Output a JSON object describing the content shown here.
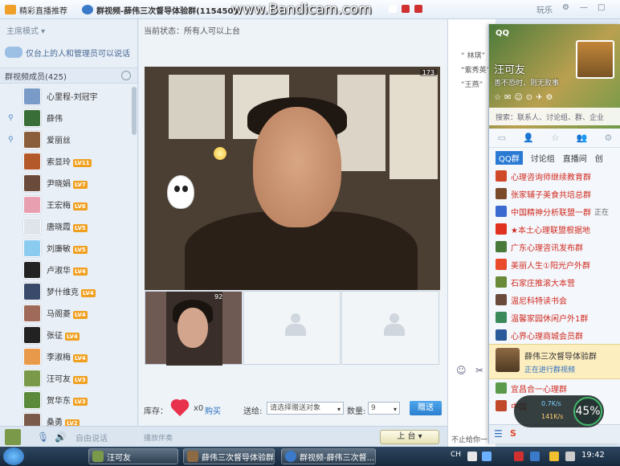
{
  "titlebar": {
    "tab1": "精彩直播推荐",
    "tab2": "群视频-薛伟三次督导体验群(1154500",
    "watermark": "www.Bandicam.com",
    "ctrl1": "玩乐",
    "ctrl2": "ᐯ"
  },
  "left": {
    "mode": "主席模式 ▾",
    "notice": "仅台上的人和管理员可以说话",
    "members_header": "群视频成员(425)",
    "members": [
      {
        "name": "心里程-刘冠宇",
        "lv": "",
        "mic": false,
        "color": "#7a9ac8"
      },
      {
        "name": "薛伟",
        "lv": "",
        "mic": true,
        "color": "#3a6e38"
      },
      {
        "name": "爱丽丝",
        "lv": "",
        "mic": true,
        "color": "#8a5e3a"
      },
      {
        "name": "索显玲",
        "lv": "LV11",
        "mic": false,
        "color": "#b45a2a"
      },
      {
        "name": "尹晓娟",
        "lv": "LV7",
        "mic": false,
        "color": "#6a4a3a"
      },
      {
        "name": "王宏梅",
        "lv": "LV6",
        "mic": false,
        "color": "#e8a0b0"
      },
      {
        "name": "唐晓霞",
        "lv": "LV5",
        "mic": false,
        "color": "#dfe4ea"
      },
      {
        "name": "刘廉敏",
        "lv": "LV5",
        "mic": false,
        "color": "#8ccbf0"
      },
      {
        "name": "卢淑华",
        "lv": "LV4",
        "mic": false,
        "color": "#222222"
      },
      {
        "name": "梦什维克",
        "lv": "LV4",
        "mic": false,
        "color": "#3a4a6a"
      },
      {
        "name": "马阁菱",
        "lv": "LV4",
        "mic": false,
        "color": "#a06a5a"
      },
      {
        "name": "张征",
        "lv": "LV4",
        "mic": false,
        "color": "#222222"
      },
      {
        "name": "李淑梅",
        "lv": "LV4",
        "mic": false,
        "color": "#e89a4a"
      },
      {
        "name": "汪可友",
        "lv": "LV3",
        "mic": false,
        "color": "#7a9a4a"
      },
      {
        "name": "贺华东",
        "lv": "LV3",
        "mic": false,
        "color": "#5a8a3a"
      },
      {
        "name": "桑勇",
        "lv": "LV2",
        "mic": false,
        "color": "#7a5a4a"
      }
    ]
  },
  "center": {
    "status": "当前状态：所有人可以上台",
    "main_count": "173",
    "thumb_count": "92",
    "inventory_label": "库存：",
    "gift_count": "x0",
    "buy": "购买",
    "send_to_label": "送给:",
    "send_to_placeholder": "请选择赠送对象",
    "qty_label": "数量:",
    "qty_value": "9",
    "send_button": "赠送",
    "free_speak": "自由说话",
    "background_music": "播放伴奏",
    "on_stage_button": "上 台"
  },
  "chat": {
    "lines": [
      "“ 林琪”",
      "“紫秀英”",
      "“王燕”"
    ]
  },
  "right_hint": "不止给你一",
  "qq": {
    "logo": "QQ",
    "nickname": "汪可友",
    "signature": "善不恐时，则无败事",
    "search": "搜索：联系人、讨论组、群、企业",
    "subtabs": [
      "QQ群",
      "讨论组",
      "直播间",
      "创"
    ],
    "groups": [
      {
        "name": "心理咨询师继续教育群",
        "color": "#d04a2a",
        "extra": ""
      },
      {
        "name": "张家辅子美食共培总群",
        "color": "#7a4a2a",
        "extra": ""
      },
      {
        "name": "中国精神分析联盟一群",
        "color": "#3a6ad0",
        "extra": "正在"
      },
      {
        "name": "★本土心理联盟根据地",
        "color": "#e03020",
        "extra": ""
      },
      {
        "name": "广东心理咨讯发布群",
        "color": "#4a7a3a",
        "extra": ""
      },
      {
        "name": "美丽人生①阳光户外群",
        "color": "#e84a2a",
        "extra": ""
      },
      {
        "name": "石家庄推滚大本营",
        "color": "#6a8a3a",
        "extra": ""
      },
      {
        "name": "温尼科特读书会",
        "color": "#6a4a3a",
        "extra": ""
      },
      {
        "name": "温馨家园休闲户外1群",
        "color": "#3a8a5a",
        "extra": ""
      },
      {
        "name": "心界心理商城会员群",
        "color": "#2a5a9a",
        "extra": ""
      }
    ],
    "selected_group": "薛伟三次督导体验群",
    "selected_sub": "正在进行群视频",
    "groups_after": [
      {
        "name": "宜昌合一心理群",
        "color": "#5a9a4a"
      },
      {
        "name": "中国",
        "color": "#c04a2a"
      }
    ]
  },
  "speed": {
    "up": "0.7K/s",
    "down": "141K/s",
    "percent": "45%"
  },
  "taskbar": {
    "items": [
      "汪可友",
      "薛伟三次督导体验群",
      "群视频-薛伟三次督..."
    ],
    "lang": "CH",
    "clock": "19:42"
  }
}
